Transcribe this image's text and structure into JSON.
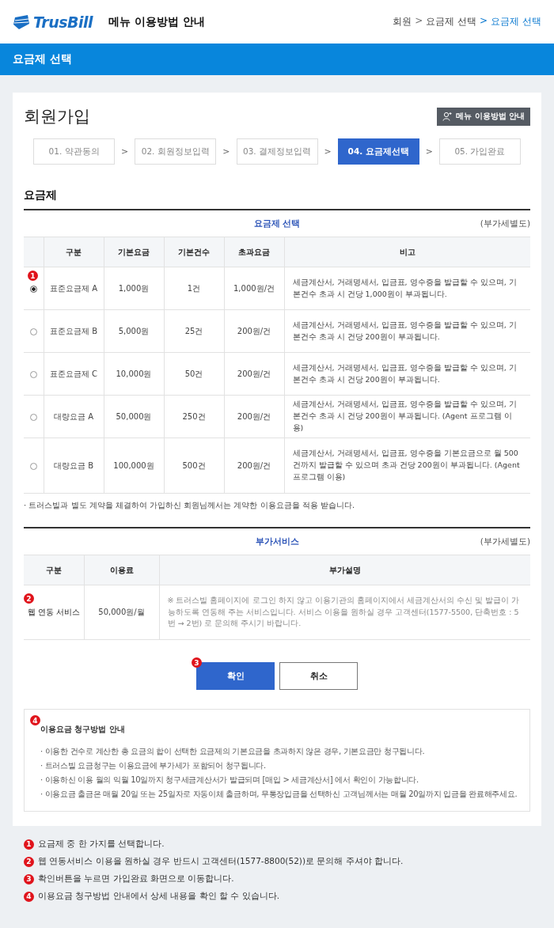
{
  "header": {
    "logo": "TrusBill",
    "title": "메뉴 이용방법 안내",
    "breadcrumb": [
      {
        "label": "회원",
        "current": false
      },
      {
        "label": "요금제 선택",
        "current": false
      },
      {
        "label": "요금제 선택",
        "current": true
      }
    ],
    "separator": ">"
  },
  "banner": "요금제 선택",
  "page": {
    "title": "회원가입",
    "guide_button": "메뉴 이용방법 안내"
  },
  "steps": [
    {
      "label": "01. 약관동의",
      "selected": false
    },
    {
      "label": "02. 회원정보입력",
      "selected": false
    },
    {
      "label": "03. 결제정보입력",
      "selected": false
    },
    {
      "label": "04. 요금제선택",
      "selected": true
    },
    {
      "label": "05. 가입완료",
      "selected": false
    }
  ],
  "step_separator": ">",
  "plans": {
    "heading": "요금제",
    "caption": "요금제 선택",
    "vat_note": "(부가세별도)",
    "columns": [
      "구분",
      "기본요금",
      "기본건수",
      "초과요금",
      "비고"
    ],
    "rows": [
      {
        "name": "표준요금제 A",
        "base_fee": "1,000원",
        "base_count": "1건",
        "extra_fee": "1,000원/건",
        "note": "세금계산서, 거래명세서, 입금표, 영수증을 발급할 수 있으며, 기본건수 초과 시 건당 1,000원이 부과됩니다.",
        "selected": true,
        "badge": "1"
      },
      {
        "name": "표준요금제 B",
        "base_fee": "5,000원",
        "base_count": "25건",
        "extra_fee": "200원/건",
        "note": "세금계산서, 거래명세서, 입금표, 영수증을 발급할 수 있으며, 기본건수 초과 시 건당 200원이 부과됩니다.",
        "selected": false
      },
      {
        "name": "표준요금제 C",
        "base_fee": "10,000원",
        "base_count": "50건",
        "extra_fee": "200원/건",
        "note": "세금계산서, 거래명세서, 입금표, 영수증을 발급할 수 있으며, 기본건수 초과 시 건당 200원이 부과됩니다.",
        "selected": false
      },
      {
        "name": "대량요금 A",
        "base_fee": "50,000원",
        "base_count": "250건",
        "extra_fee": "200원/건",
        "note": "세금계산서, 거래명세서, 입금표, 영수증을 발급할 수 있으며, 기본건수 초과 시 건당 200원이 부과됩니다. (Agent 프로그램 이용)",
        "selected": false
      },
      {
        "name": "대량요금 B",
        "base_fee": "100,000원",
        "base_count": "500건",
        "extra_fee": "200원/건",
        "note": "세금계산서, 거래명세서, 입금표, 영수증을 기본요금으로 월 500건까지 발급할 수 있으며 초과 건당 200원이 부과됩니다. (Agent 프로그램 이용)",
        "selected": false
      }
    ],
    "footnote": "· 트러스빌과 별도 계약을 체결하여 가입하신 회원님께서는 계약한 이용요금을 적용 받습니다."
  },
  "addons": {
    "caption": "부가서비스",
    "vat_note": "(부가세별도)",
    "columns": [
      "구분",
      "이용료",
      "부가설명"
    ],
    "rows": [
      {
        "name": "웹 연동 서비스",
        "fee": "50,000원/월",
        "description": "※ 트러스빌 홈페이지에 로그인 하지 않고 이용기관의 홈페이지에서 세금계산서의 수신 및 발급이 가능하도록 연동해 주는 서비스입니다. 서비스 이용을 원하실 경우 고객센터(1577-5500, 단축번호 : 5번 → 2번) 로 문의해 주시기 바랍니다.",
        "badge": "2"
      }
    ]
  },
  "buttons": {
    "confirm": "확인",
    "confirm_badge": "3",
    "cancel": "취소"
  },
  "billing_info": {
    "badge": "4",
    "title": "이용요금 청구방법 안내",
    "items": [
      "· 이용한 건수로 계산한 총 요금의 합이 선택한 요금제의 기본요금을 초과하지 않은 경우, 기본요금만 청구됩니다.",
      "· 트러스빌 요금청구는 이용요금에 부가세가 포함되어 청구됩니다.",
      "· 이용하신 이용 월의 익월 10일까지 청구세금계산서가 발급되며 [매입 > 세금계산서] 에서 확인이 가능합니다.",
      "· 이용요금 출금은 매월 20일 또는 25일자로 자동이체 출금하며, 무통장입금을 선택하신 고객님께서는 매월 20일까지 입금을 완료해주세요."
    ]
  },
  "guide_notes": [
    {
      "badge": "1",
      "text": "요금제 중 한 가지를 선택합니다."
    },
    {
      "badge": "2",
      "text": "웹 연동서비스 이용을 원하실 경우 반드시 고객센터(1577-8800(52))로 문의해 주셔야 합니다."
    },
    {
      "badge": "3",
      "text": "확인버튼을 누르면 가입완료 화면으로 이동합니다."
    },
    {
      "badge": "4",
      "text": "이용요금 청구방법 안내에서 상세 내용을 확인 할 수 있습니다."
    }
  ]
}
